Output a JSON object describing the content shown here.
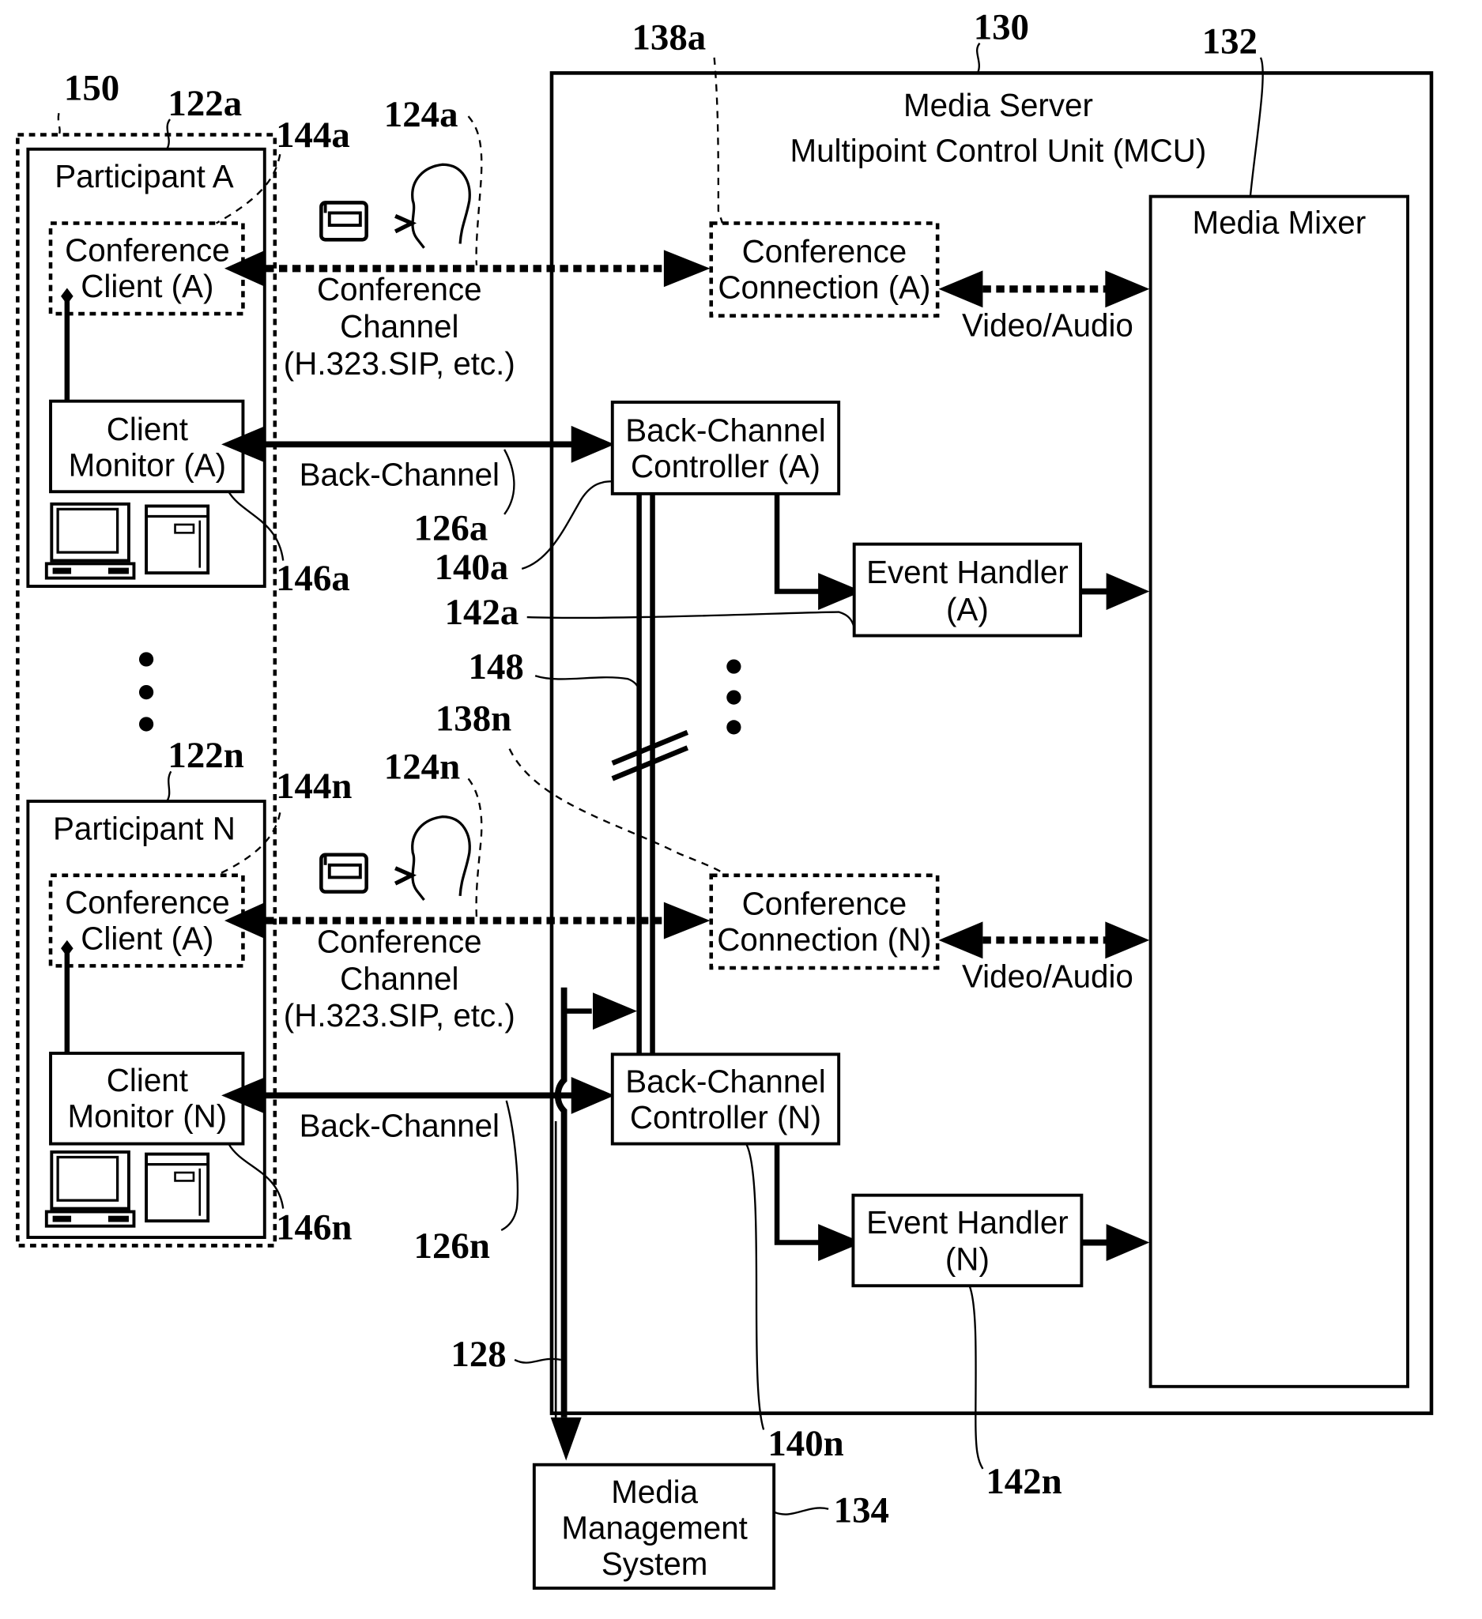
{
  "figure": {
    "media_server": {
      "ref": "130",
      "title_line1": "Media Server",
      "title_line2": "Multipoint Control Unit (MCU)"
    },
    "media_mixer": {
      "ref": "132",
      "label": "Media Mixer"
    },
    "participant_group": {
      "ref": "150"
    },
    "participants": [
      {
        "ref": "122a",
        "title": "Participant A",
        "conference_client": {
          "ref": "144a",
          "line1": "Conference",
          "line2": "Client (A)"
        },
        "client_monitor": {
          "ref": "146a",
          "line1": "Client",
          "line2": "Monitor (A)"
        },
        "conference_channel": {
          "ref": "124a",
          "line1": "Conference",
          "line2": "Channel",
          "line3": "(H.323.SIP, etc.)"
        },
        "back_channel": {
          "ref": "126a",
          "label": "Back-Channel"
        }
      },
      {
        "ref": "122n",
        "title": "Participant N",
        "conference_client": {
          "ref": "144n",
          "line1": "Conference",
          "line2": "Client (A)"
        },
        "client_monitor": {
          "ref": "146n",
          "line1": "Client",
          "line2": "Monitor (N)"
        },
        "conference_channel": {
          "ref": "124n",
          "line1": "Conference",
          "line2": "Channel",
          "line3": "(H.323.SIP, etc.)"
        },
        "back_channel": {
          "ref": "126n",
          "label": "Back-Channel"
        }
      }
    ],
    "conference_connections": [
      {
        "ref": "138a",
        "line1": "Conference",
        "line2": "Connection (A)",
        "link_label": "Video/Audio"
      },
      {
        "ref": "138n",
        "line1": "Conference",
        "line2": "Connection (N)",
        "link_label": "Video/Audio"
      }
    ],
    "back_channel_controllers": [
      {
        "ref": "140a",
        "line1": "Back-Channel",
        "line2": "Controller (A)"
      },
      {
        "ref": "140n",
        "line1": "Back-Channel",
        "line2": "Controller (N)"
      }
    ],
    "event_handlers": [
      {
        "ref": "142a",
        "line1": "Event Handler",
        "line2": "(A)"
      },
      {
        "ref": "142n",
        "line1": "Event Handler",
        "line2": "(N)"
      }
    ],
    "controller_bus": {
      "ref": "148"
    },
    "management_link": {
      "ref": "128"
    },
    "media_management_system": {
      "ref": "134",
      "line1": "Media",
      "line2": "Management",
      "line3": "System"
    },
    "icons": [
      "telephone-icon",
      "speaking-head-icon",
      "desktop-computer-icon",
      "server-tower-icon",
      "ellipsis-vertical-icon",
      "break-mark-icon"
    ]
  }
}
